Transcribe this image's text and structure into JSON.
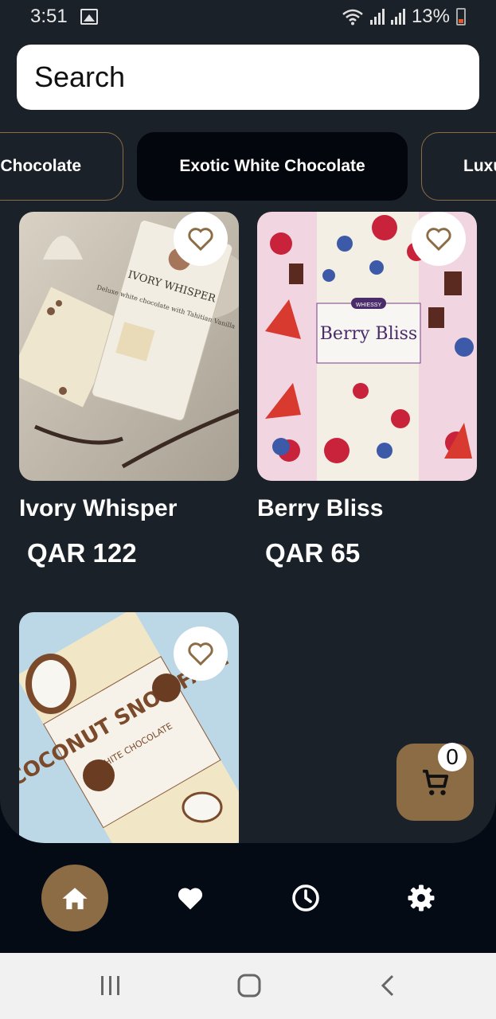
{
  "status_bar": {
    "time": "3:51",
    "battery": "13%"
  },
  "search": {
    "placeholder": "Search"
  },
  "categories": [
    {
      "label": "Chocolate",
      "active": false
    },
    {
      "label": "Exotic White Chocolate",
      "active": true
    },
    {
      "label": "Luxu",
      "active": false
    }
  ],
  "products": [
    {
      "name": "Ivory Whisper",
      "price": "QAR 122",
      "package_text": "IVORY WHISPER",
      "package_subtext": "Deluxe white chocolate with Tahitian Vanilla"
    },
    {
      "name": "Berry Bliss",
      "price": "QAR 65",
      "package_text": "Berry Bliss",
      "package_subtext": "WHIESSY"
    },
    {
      "name": "",
      "price": "",
      "package_text": "COCONUT SNOWFALL",
      "package_subtext": "WHITE CHOCOLATE"
    }
  ],
  "cart": {
    "count": "0"
  },
  "colors": {
    "accent": "#8c6c45",
    "background": "#1b2128",
    "nav_background": "#050b14",
    "active_category": "#03060c"
  },
  "icons": {
    "favorite": "heart-outline-icon",
    "cart": "cart-icon",
    "home": "home-icon",
    "favorites_nav": "heart-icon",
    "history": "clock-icon",
    "settings": "gear-icon"
  }
}
